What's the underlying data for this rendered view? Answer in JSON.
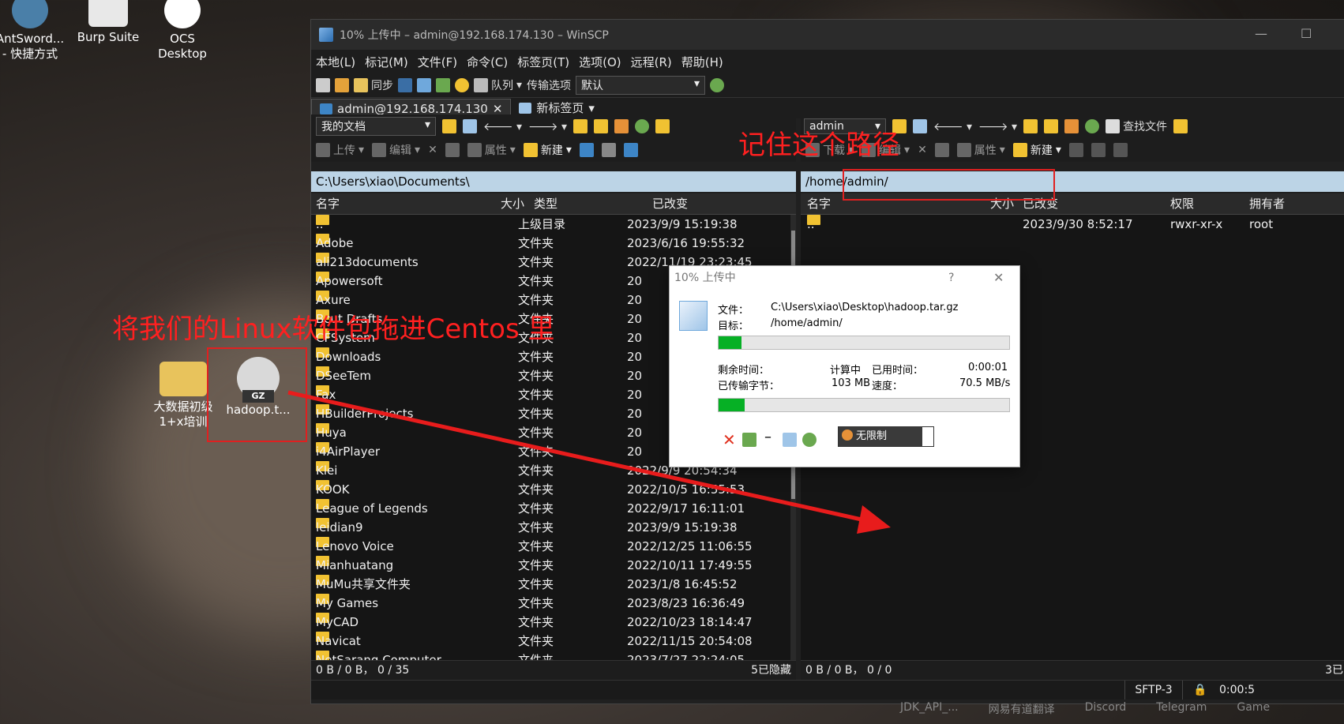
{
  "desktop": {
    "icons": [
      {
        "label": "AntSword...\n- 快捷方式"
      },
      {
        "label": "Burp Suite"
      },
      {
        "label": "OCS\nDesktop"
      },
      {
        "label": "大数据初级\n1+x培训"
      },
      {
        "label": "hadoop.t..."
      }
    ],
    "annotation_drag": "将我们的Linux软件包拖进Centos 里",
    "annotation_path": "记住这个路径",
    "taskbar_labels": [
      "JDK_API_...",
      "网易有道翻译",
      "Discord",
      "Telegram",
      "Game"
    ]
  },
  "window": {
    "title": "10% 上传中 – admin@192.168.174.130 – WinSCP",
    "menu": [
      "本地(L)",
      "标记(M)",
      "文件(F)",
      "命令(C)",
      "标签页(T)",
      "选项(O)",
      "远程(R)",
      "帮助(H)"
    ],
    "toolbar": {
      "sync": "同步",
      "queue": "队列",
      "transfer_options": "传输选项",
      "transfer_preset": "默认"
    },
    "tabs": [
      {
        "label": "admin@192.168.174.130"
      },
      {
        "label": "新标签页"
      }
    ],
    "local": {
      "location_dropdown": "我的文档",
      "upload": "上传",
      "edit": "编辑",
      "properties": "属性",
      "new": "新建",
      "path": "C:\\Users\\xiao\\Documents\\",
      "columns": [
        "名字",
        "大小",
        "类型",
        "已改变"
      ],
      "files": [
        {
          "name": "..",
          "type": "上级目录",
          "changed": "2023/9/9 15:19:38"
        },
        {
          "name": "Adobe",
          "type": "文件夹",
          "changed": "2023/6/16 19:55:32"
        },
        {
          "name": "ali213documents",
          "type": "文件夹",
          "changed": "2022/11/19 23:23:45"
        },
        {
          "name": "Apowersoft",
          "type": "文件夹",
          "changed": "20"
        },
        {
          "name": "Axure",
          "type": "文件夹",
          "changed": "20"
        },
        {
          "name": "Bcut Drafts",
          "type": "文件夹",
          "changed": "20"
        },
        {
          "name": "CFSystem",
          "type": "文件夹",
          "changed": "20"
        },
        {
          "name": "Downloads",
          "type": "文件夹",
          "changed": "20"
        },
        {
          "name": "DSeeTem",
          "type": "文件夹",
          "changed": "20"
        },
        {
          "name": "Fax",
          "type": "文件夹",
          "changed": "20"
        },
        {
          "name": "HBuilderProjects",
          "type": "文件夹",
          "changed": "20"
        },
        {
          "name": "Huya",
          "type": "文件夹",
          "changed": "20"
        },
        {
          "name": "i4AirPlayer",
          "type": "文件夹",
          "changed": "20"
        },
        {
          "name": "Klei",
          "type": "文件夹",
          "changed": "2022/9/9 20:54:34"
        },
        {
          "name": "KOOK",
          "type": "文件夹",
          "changed": "2022/10/5 16:55:53"
        },
        {
          "name": "League of Legends",
          "type": "文件夹",
          "changed": "2022/9/17 16:11:01"
        },
        {
          "name": "leidian9",
          "type": "文件夹",
          "changed": "2023/9/9 15:19:38"
        },
        {
          "name": "Lenovo Voice",
          "type": "文件夹",
          "changed": "2022/12/25 11:06:55"
        },
        {
          "name": "Mianhuatang",
          "type": "文件夹",
          "changed": "2022/10/11 17:49:55"
        },
        {
          "name": "MuMu共享文件夹",
          "type": "文件夹",
          "changed": "2023/1/8 16:45:52"
        },
        {
          "name": "My Games",
          "type": "文件夹",
          "changed": "2023/8/23 16:36:49"
        },
        {
          "name": "MyCAD",
          "type": "文件夹",
          "changed": "2022/10/23 18:14:47"
        },
        {
          "name": "Navicat",
          "type": "文件夹",
          "changed": "2022/11/15 20:54:08"
        },
        {
          "name": "NetSarang Computer",
          "type": "文件夹",
          "changed": "2023/7/27 22:24:05"
        }
      ],
      "status_left": "0 B / 0 B，  0 / 35",
      "status_right": "5已隐藏"
    },
    "remote": {
      "location_dropdown": "admin",
      "find_files": "查找文件",
      "download": "下载",
      "edit": "编辑",
      "properties": "属性",
      "new": "新建",
      "path": "/home/admin/",
      "columns": [
        "名字",
        "大小",
        "已改变",
        "权限",
        "拥有者"
      ],
      "files": [
        {
          "name": "..",
          "changed": "2023/9/30 8:52:17",
          "perms": "rwxr-xr-x",
          "owner": "root"
        }
      ],
      "status_left": "0 B / 0 B，  0 / 0",
      "status_right": "3已"
    },
    "bottom": {
      "protocol": "SFTP-3",
      "time": "0:00:5"
    }
  },
  "dialog": {
    "title": "10% 上传中",
    "help": "?",
    "file_label": "文件：",
    "file_value": "C:\\Users\\xiao\\Desktop\\hadoop.tar.gz",
    "target_label": "目标：",
    "target_value": "/home/admin/",
    "remaining_label": "剩余时间：",
    "remaining_value": "计算中",
    "elapsed_label": "已用时间：",
    "elapsed_value": "0:00:01",
    "bytes_label": "已传输字节：",
    "bytes_value": "103 MB",
    "speed_label": "速度：",
    "speed_value": "70.5 MB/s",
    "progress_file": 0.08,
    "progress_total": 0.09,
    "speed_limit": "无限制"
  }
}
